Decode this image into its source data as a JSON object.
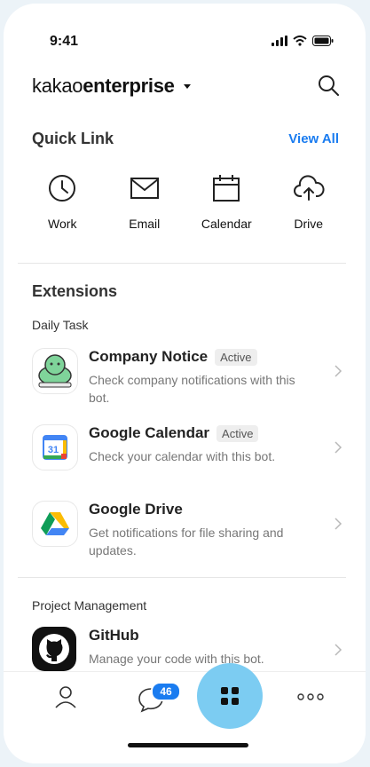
{
  "status_bar": {
    "time": "9:41",
    "icons": [
      "signal-icon",
      "wifi-icon",
      "battery-icon"
    ]
  },
  "header": {
    "brand_light": "kakao",
    "brand_bold": "enterprise",
    "icons": [
      "chevron-down-icon",
      "search-icon"
    ]
  },
  "quick_link": {
    "title": "Quick Link",
    "view_all": "View All",
    "items": [
      {
        "label": "Work",
        "icon": "clock-icon"
      },
      {
        "label": "Email",
        "icon": "mail-icon"
      },
      {
        "label": "Calendar",
        "icon": "calendar-icon"
      },
      {
        "label": "Drive",
        "icon": "cloud-upload-icon"
      }
    ]
  },
  "extensions": {
    "title": "Extensions",
    "groups": [
      {
        "label": "Daily Task",
        "items": [
          {
            "title": "Company Notice",
            "badge": "Active",
            "desc": "Check company notifications with this bot.",
            "icon": "notice-bot-icon"
          },
          {
            "title": "Google Calendar",
            "badge": "Active",
            "desc": "Check your calendar with this bot.",
            "icon": "google-calendar-icon",
            "icon_text": "31"
          },
          {
            "title": "Google Drive",
            "badge": "",
            "desc": "Get notifications for file sharing and updates.",
            "icon": "google-drive-icon"
          }
        ]
      },
      {
        "label": "Project Management",
        "items": [
          {
            "title": "GitHub",
            "badge": "",
            "desc": "Manage your code with this bot.",
            "icon": "github-icon"
          }
        ]
      }
    ]
  },
  "bottom_nav": {
    "chat_badge": "46",
    "icons": [
      "profile-icon",
      "chat-icon",
      "apps-grid-icon",
      "more-icon"
    ]
  },
  "colors": {
    "accent": "#1a7cf0",
    "fab": "#7cccf2",
    "background": "#ecf3f8"
  }
}
